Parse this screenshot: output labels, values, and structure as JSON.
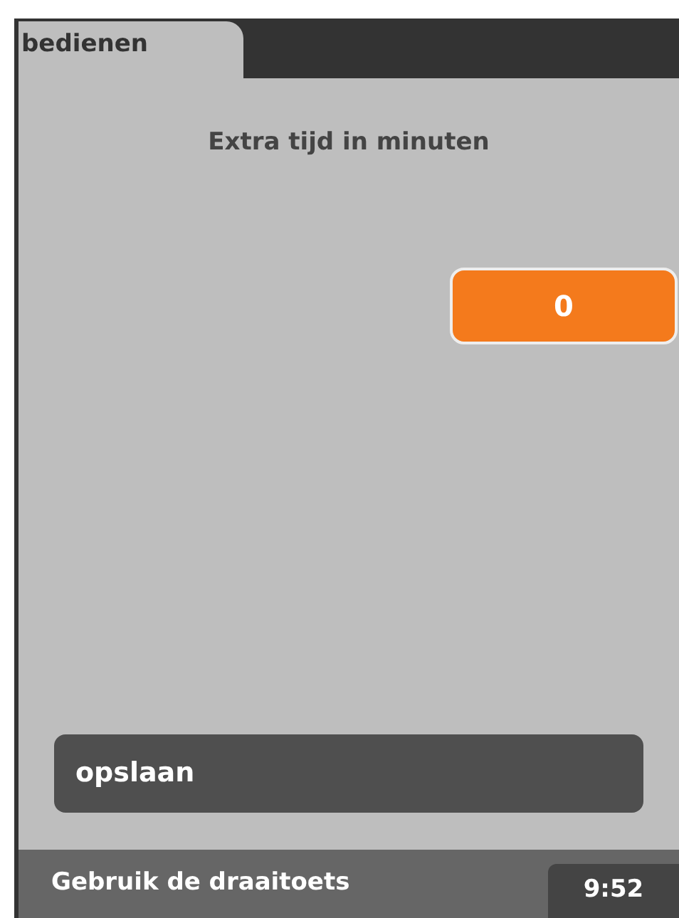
{
  "tabs": [
    {
      "label": "bedienen",
      "selected": true
    }
  ],
  "setting": {
    "label": "Extra tijd in minuten",
    "value": "0"
  },
  "save_button": {
    "label": "opslaan"
  },
  "status_bar": {
    "hint": "Gebruik de draaitoets",
    "time": "9:52"
  }
}
